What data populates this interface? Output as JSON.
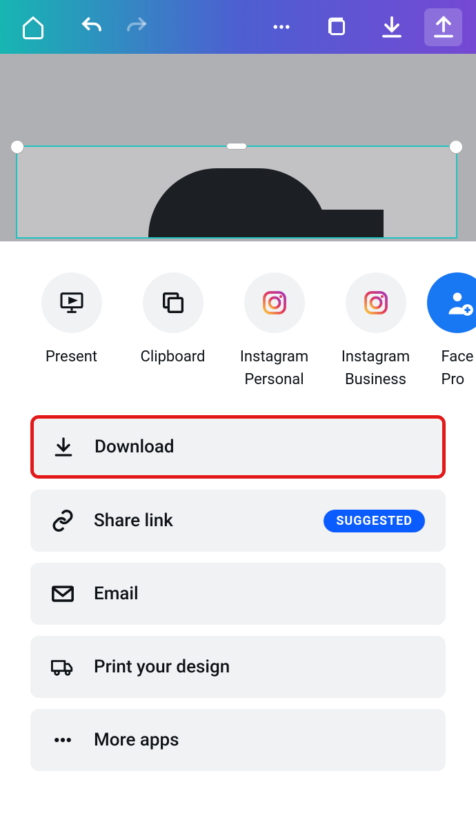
{
  "quick_actions": [
    {
      "label": "Present"
    },
    {
      "label": "Clipboard"
    },
    {
      "label": "Instagram Personal"
    },
    {
      "label": "Instagram Business"
    },
    {
      "label": "Facebook Profile"
    }
  ],
  "actions": {
    "download": {
      "label": "Download"
    },
    "share_link": {
      "label": "Share link",
      "badge": "SUGGESTED"
    },
    "email": {
      "label": "Email"
    },
    "print": {
      "label": "Print your design"
    },
    "more": {
      "label": "More apps"
    }
  }
}
